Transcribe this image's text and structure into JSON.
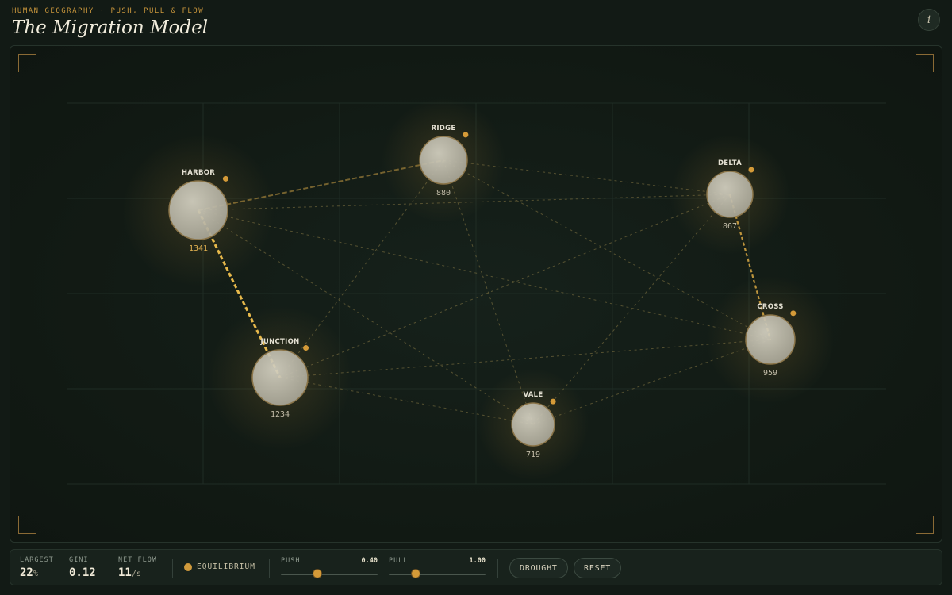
{
  "header": {
    "eyebrow": "HUMAN GEOGRAPHY · PUSH, PULL & FLOW",
    "title": "The Migration Model",
    "info_label": "i"
  },
  "colors": {
    "accent": "#c9963c",
    "flow_hot": "#f2c14e",
    "flow_faint": "#8a7a45",
    "node_fill": "#b9b6a6",
    "background": "#121a15"
  },
  "nodes": [
    {
      "id": "harbor",
      "label": "HARBOR",
      "population": "1341",
      "hot": true
    },
    {
      "id": "ridge",
      "label": "RIDGE",
      "population": "880",
      "hot": false
    },
    {
      "id": "delta",
      "label": "DELTA",
      "population": "867",
      "hot": false
    },
    {
      "id": "junction",
      "label": "JUNCTION",
      "population": "1234",
      "hot": false
    },
    {
      "id": "cross",
      "label": "CROSS",
      "population": "959",
      "hot": false
    },
    {
      "id": "vale",
      "label": "VALE",
      "population": "719",
      "hot": false
    }
  ],
  "stats": {
    "largest": {
      "label": "LARGEST",
      "value": "22",
      "unit": "%"
    },
    "gini": {
      "label": "GINI",
      "value": "0.12"
    },
    "net_flow": {
      "label": "NET FLOW",
      "value": "11",
      "unit": "/s"
    }
  },
  "status": {
    "text": "EQUILIBRIUM"
  },
  "controls": {
    "push": {
      "label": "PUSH",
      "value_text": "0.40",
      "fraction": 0.38
    },
    "pull": {
      "label": "PULL",
      "value_text": "1.00",
      "fraction": 0.28
    }
  },
  "buttons": {
    "drought": "DROUGHT",
    "reset": "RESET"
  }
}
